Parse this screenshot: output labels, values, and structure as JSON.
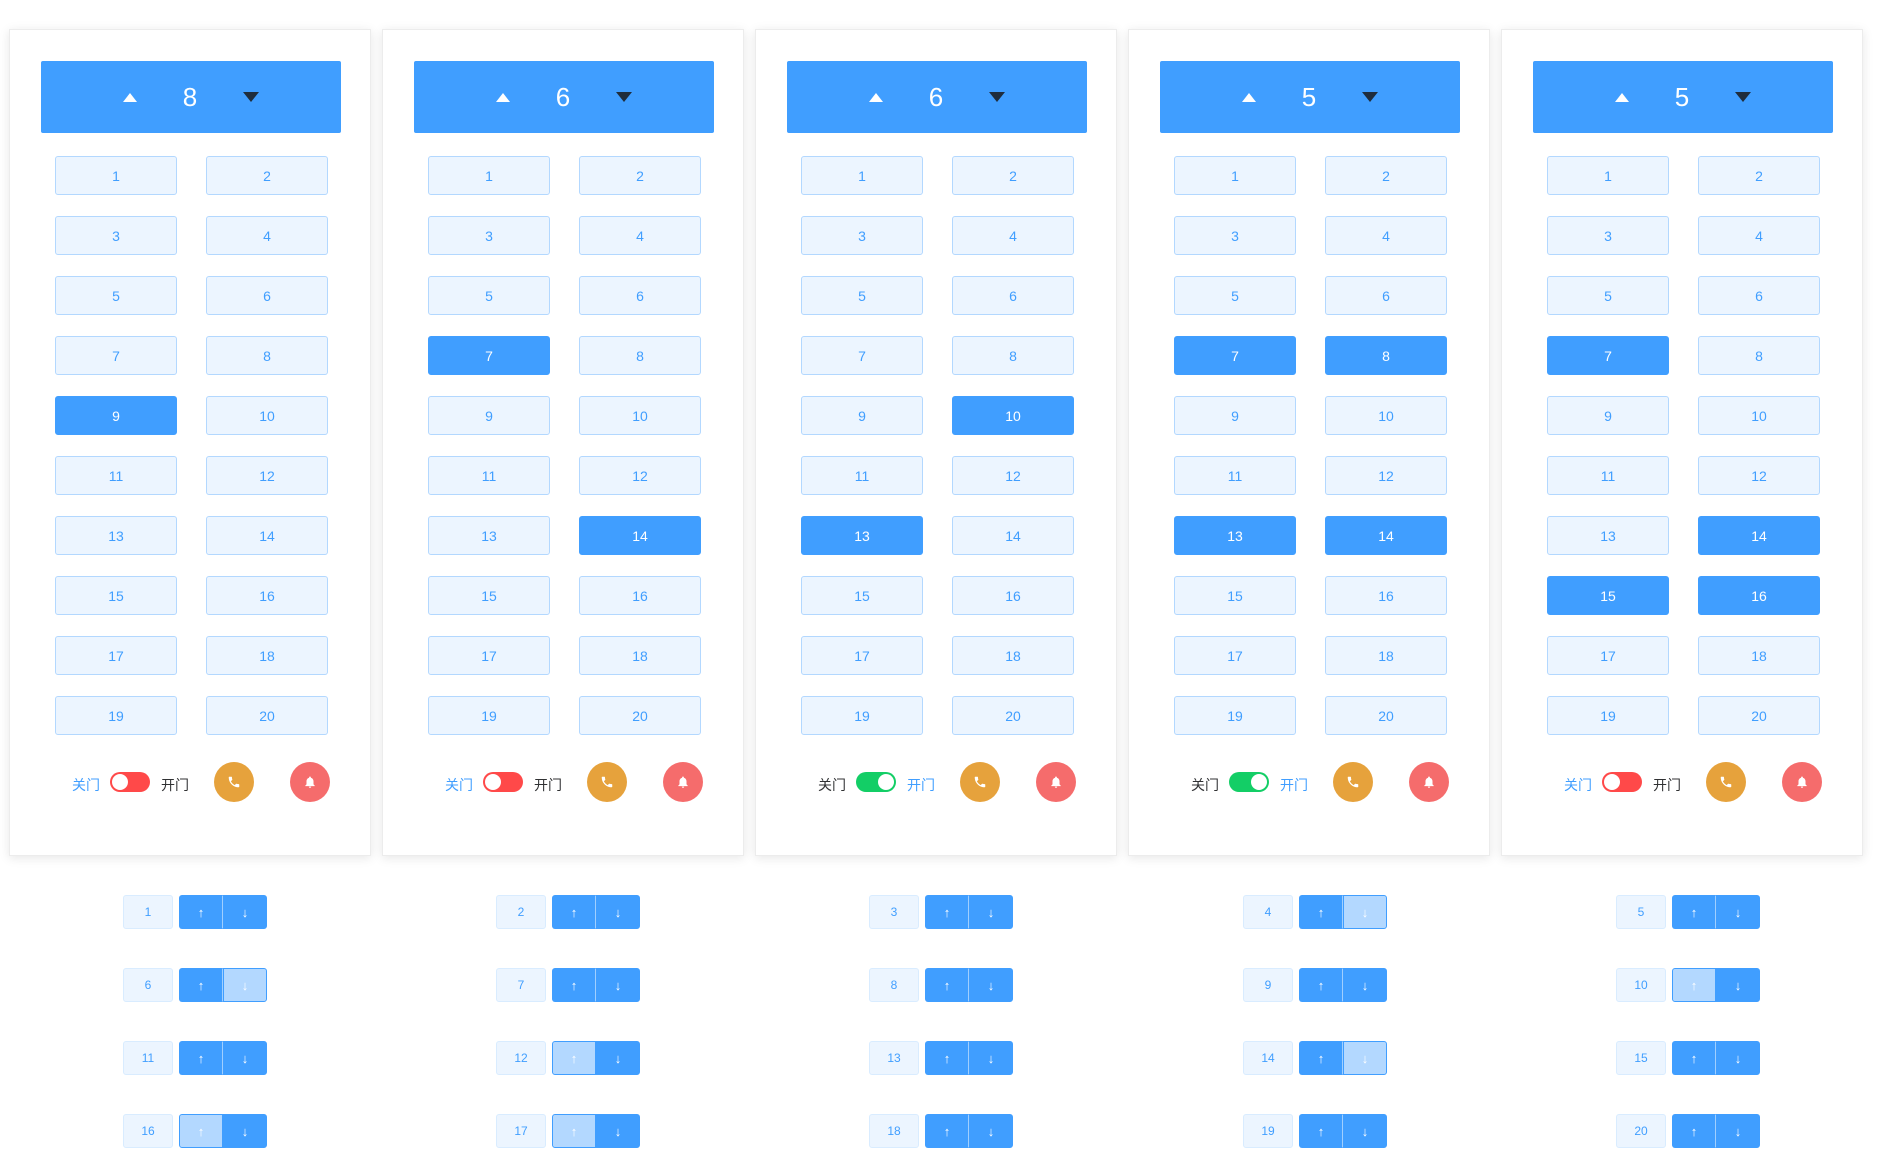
{
  "labels": {
    "door_close": "关门",
    "door_open": "开门"
  },
  "icons": {
    "up": "caret-up-icon",
    "down": "caret-down-icon",
    "call": "phone-icon",
    "alarm": "bell-icon",
    "hall_up": "arrow-up-icon",
    "hall_down": "arrow-down-icon"
  },
  "colors": {
    "primary": "#409eff",
    "primary_light": "#ecf5ff",
    "call": "#e6a23c",
    "alarm": "#f56c6c",
    "switch_off": "#ff4949",
    "switch_on": "#13ce66"
  },
  "elevators": [
    {
      "current_floor": "8",
      "floors": [
        "1",
        "2",
        "3",
        "4",
        "5",
        "6",
        "7",
        "8",
        "9",
        "10",
        "11",
        "12",
        "13",
        "14",
        "15",
        "16",
        "17",
        "18",
        "19",
        "20"
      ],
      "active_floors": [
        "9"
      ],
      "door_open": false
    },
    {
      "current_floor": "6",
      "floors": [
        "1",
        "2",
        "3",
        "4",
        "5",
        "6",
        "7",
        "8",
        "9",
        "10",
        "11",
        "12",
        "13",
        "14",
        "15",
        "16",
        "17",
        "18",
        "19",
        "20"
      ],
      "active_floors": [
        "7",
        "14"
      ],
      "door_open": false
    },
    {
      "current_floor": "6",
      "floors": [
        "1",
        "2",
        "3",
        "4",
        "5",
        "6",
        "7",
        "8",
        "9",
        "10",
        "11",
        "12",
        "13",
        "14",
        "15",
        "16",
        "17",
        "18",
        "19",
        "20"
      ],
      "active_floors": [
        "10",
        "13"
      ],
      "door_open": true
    },
    {
      "current_floor": "5",
      "floors": [
        "1",
        "2",
        "3",
        "4",
        "5",
        "6",
        "7",
        "8",
        "9",
        "10",
        "11",
        "12",
        "13",
        "14",
        "15",
        "16",
        "17",
        "18",
        "19",
        "20"
      ],
      "active_floors": [
        "7",
        "8",
        "13",
        "14"
      ],
      "door_open": true
    },
    {
      "current_floor": "5",
      "floors": [
        "1",
        "2",
        "3",
        "4",
        "5",
        "6",
        "7",
        "8",
        "9",
        "10",
        "11",
        "12",
        "13",
        "14",
        "15",
        "16",
        "17",
        "18",
        "19",
        "20"
      ],
      "active_floors": [
        "7",
        "14",
        "15",
        "16"
      ],
      "door_open": false
    }
  ],
  "hall_calls": [
    {
      "floor": "1",
      "up_label": "↑",
      "down_label": "↓",
      "up_active": false,
      "down_active": false
    },
    {
      "floor": "2",
      "up_label": "↑",
      "down_label": "↓",
      "up_active": false,
      "down_active": false
    },
    {
      "floor": "3",
      "up_label": "↑",
      "down_label": "↓",
      "up_active": false,
      "down_active": false
    },
    {
      "floor": "4",
      "up_label": "↑",
      "down_label": "↓",
      "up_active": false,
      "down_active": true
    },
    {
      "floor": "5",
      "up_label": "↑",
      "down_label": "↓",
      "up_active": false,
      "down_active": false
    },
    {
      "floor": "6",
      "up_label": "↑",
      "down_label": "↓",
      "up_active": false,
      "down_active": true
    },
    {
      "floor": "7",
      "up_label": "↑",
      "down_label": "↓",
      "up_active": false,
      "down_active": false
    },
    {
      "floor": "8",
      "up_label": "↑",
      "down_label": "↓",
      "up_active": false,
      "down_active": false
    },
    {
      "floor": "9",
      "up_label": "↑",
      "down_label": "↓",
      "up_active": false,
      "down_active": false
    },
    {
      "floor": "10",
      "up_label": "↑",
      "down_label": "↓",
      "up_active": true,
      "down_active": false
    },
    {
      "floor": "11",
      "up_label": "↑",
      "down_label": "↓",
      "up_active": false,
      "down_active": false
    },
    {
      "floor": "12",
      "up_label": "↑",
      "down_label": "↓",
      "up_active": true,
      "down_active": false
    },
    {
      "floor": "13",
      "up_label": "↑",
      "down_label": "↓",
      "up_active": false,
      "down_active": false
    },
    {
      "floor": "14",
      "up_label": "↑",
      "down_label": "↓",
      "up_active": false,
      "down_active": true
    },
    {
      "floor": "15",
      "up_label": "↑",
      "down_label": "↓",
      "up_active": false,
      "down_active": false
    },
    {
      "floor": "16",
      "up_label": "↑",
      "down_label": "↓",
      "up_active": true,
      "down_active": false
    },
    {
      "floor": "17",
      "up_label": "↑",
      "down_label": "↓",
      "up_active": true,
      "down_active": false
    },
    {
      "floor": "18",
      "up_label": "↑",
      "down_label": "↓",
      "up_active": false,
      "down_active": false
    },
    {
      "floor": "19",
      "up_label": "↑",
      "down_label": "↓",
      "up_active": false,
      "down_active": false
    },
    {
      "floor": "20",
      "up_label": "↑",
      "down_label": "↓",
      "up_active": false,
      "down_active": false
    }
  ]
}
